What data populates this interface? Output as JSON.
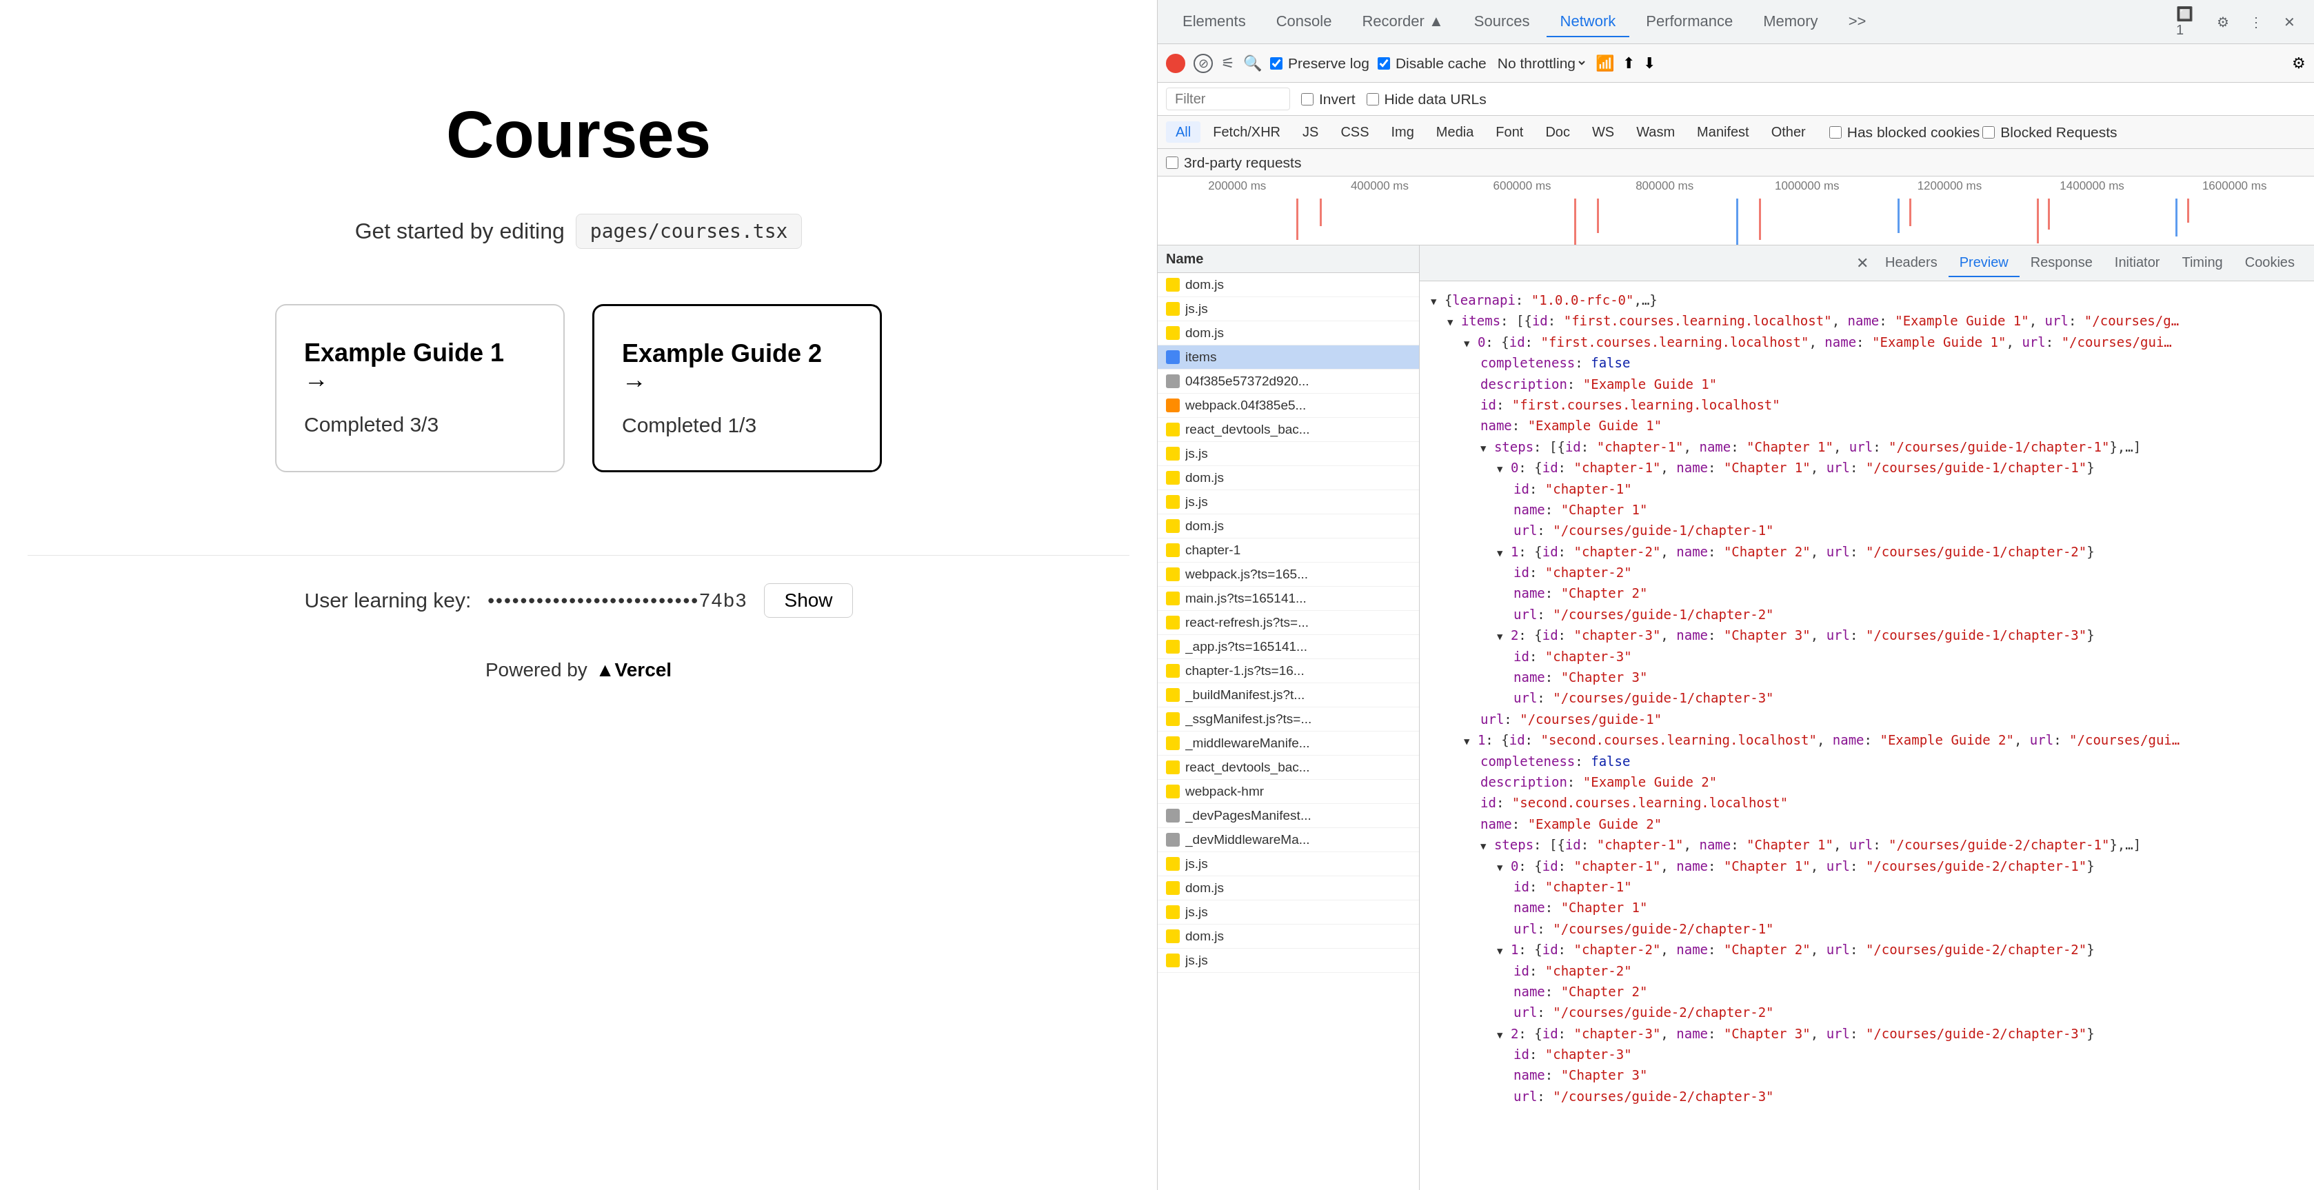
{
  "webpage": {
    "title": "Courses",
    "editHint": {
      "prefix": "Get started by editing",
      "file": "pages/courses.tsx"
    },
    "guides": [
      {
        "title": "Example Guide 1 →",
        "progress": "Completed 3/3",
        "active": false
      },
      {
        "title": "Example Guide 2 →",
        "progress": "Completed 1/3",
        "active": true
      }
    ],
    "learningKey": {
      "label": "User learning key:",
      "value": "••••••••••••••••••••••••••74b3",
      "showBtn": "Show"
    },
    "poweredBy": "Powered by",
    "vercel": "▲Vercel"
  },
  "devtools": {
    "tabs": [
      {
        "label": "Elements"
      },
      {
        "label": "Console"
      },
      {
        "label": "Recorder ▲"
      },
      {
        "label": "Sources"
      },
      {
        "label": "Network",
        "active": true
      },
      {
        "label": "Performance"
      },
      {
        "label": "Memory"
      },
      {
        "label": ">>"
      }
    ],
    "toolbar": {
      "preserveLog": "Preserve log",
      "disableCache": "Disable cache",
      "noThrottling": "No throttling",
      "invert": "Invert",
      "hideDataUrls": "Hide data URLs"
    },
    "filterTypes": [
      "All",
      "Fetch/XHR",
      "JS",
      "CSS",
      "Img",
      "Media",
      "Font",
      "Doc",
      "WS",
      "Wasm",
      "Manifest",
      "Other"
    ],
    "extraFilters": [
      "Has blocked cookies",
      "Blocked Requests"
    ],
    "thirdParty": "3rd-party requests",
    "timelineMarkers": [
      "200000 ms",
      "400000 ms",
      "600000 ms",
      "800000 ms",
      "1000000 ms",
      "1200000 ms",
      "1400000 ms",
      "1600000 ms"
    ],
    "panelTabs": [
      "Headers",
      "Preview",
      "Response",
      "Initiator",
      "Timing",
      "Cookies"
    ],
    "activeTab": "Preview",
    "files": [
      {
        "name": "dom.js",
        "type": "yellow"
      },
      {
        "name": "js.js",
        "type": "yellow"
      },
      {
        "name": "dom.js",
        "type": "yellow"
      },
      {
        "name": "items",
        "type": "blue",
        "selected": true
      },
      {
        "name": "04f385e57372d920...",
        "type": "gray"
      },
      {
        "name": "webpack.04f385e5...",
        "type": "orange"
      },
      {
        "name": "react_devtools_bac...",
        "type": "yellow"
      },
      {
        "name": "js.js",
        "type": "yellow"
      },
      {
        "name": "dom.js",
        "type": "yellow"
      },
      {
        "name": "js.js",
        "type": "yellow"
      },
      {
        "name": "dom.js",
        "type": "yellow"
      },
      {
        "name": "chapter-1",
        "type": "yellow"
      },
      {
        "name": "webpack.js?ts=165...",
        "type": "yellow"
      },
      {
        "name": "main.js?ts=165141...",
        "type": "yellow"
      },
      {
        "name": "react-refresh.js?ts=...",
        "type": "yellow"
      },
      {
        "name": "_app.js?ts=165141...",
        "type": "yellow"
      },
      {
        "name": "chapter-1.js?ts=16...",
        "type": "yellow"
      },
      {
        "name": "_buildManifest.js?t...",
        "type": "yellow"
      },
      {
        "name": "_ssgManifest.js?ts=...",
        "type": "yellow"
      },
      {
        "name": "_middlewareManife...",
        "type": "yellow"
      },
      {
        "name": "react_devtools_bac...",
        "type": "yellow"
      },
      {
        "name": "webpack-hmr",
        "type": "yellow"
      },
      {
        "name": "_devPagesManifest...",
        "type": "gray"
      },
      {
        "name": "_devMiddlewareMa...",
        "type": "gray"
      },
      {
        "name": "js.js",
        "type": "yellow"
      },
      {
        "name": "dom.js",
        "type": "yellow"
      },
      {
        "name": "js.js",
        "type": "yellow"
      },
      {
        "name": "dom.js",
        "type": "yellow"
      },
      {
        "name": "js.js",
        "type": "yellow"
      }
    ],
    "nameColumnHeader": "Name",
    "previewContent": {
      "lines": [
        "▼ {learnapi: \"1.0.0-rfc-0\",…}",
        "  ▼ items: [{id: \"first.courses.learning.localhost\", name: \"Example Guide 1\", url: \"/courses/g…",
        "    ▼ 0: {id: \"first.courses.learning.localhost\", name: \"Example Guide 1\", url: \"/courses/gui…",
        "        completeness: false",
        "        description: \"Example Guide 1\"",
        "        id: \"first.courses.learning.localhost\"",
        "        name: \"Example Guide 1\"",
        "      ▼ steps: [{id: \"chapter-1\", name: \"Chapter 1\", url: \"/courses/guide-1/chapter-1\"},…]",
        "        ▼ 0: {id: \"chapter-1\", name: \"Chapter 1\", url: \"/courses/guide-1/chapter-1\"}",
        "            id: \"chapter-1\"",
        "            name: \"Chapter 1\"",
        "            url: \"/courses/guide-1/chapter-1\"",
        "        ▼ 1: {id: \"chapter-2\", name: \"Chapter 2\", url: \"/courses/guide-1/chapter-2\"}",
        "            id: \"chapter-2\"",
        "            name: \"Chapter 2\"",
        "            url: \"/courses/guide-1/chapter-2\"",
        "        ▼ 2: {id: \"chapter-3\", name: \"Chapter 3\", url: \"/courses/guide-1/chapter-3\"}",
        "            id: \"chapter-3\"",
        "            name: \"Chapter 3\"",
        "            url: \"/courses/guide-1/chapter-3\"",
        "        url: \"/courses/guide-1\"",
        "    ▼ 1: {id: \"second.courses.learning.localhost\", name: \"Example Guide 2\", url: \"/courses/gui…",
        "        completeness: false",
        "        description: \"Example Guide 2\"",
        "        id: \"second.courses.learning.localhost\"",
        "        name: \"Example Guide 2\"",
        "      ▼ steps: [{id: \"chapter-1\", name: \"Chapter 1\", url: \"/courses/guide-2/chapter-1\"},…]",
        "        ▼ 0: {id: \"chapter-1\", name: \"Chapter 1\", url: \"/courses/guide-2/chapter-1\"}",
        "            id: \"chapter-1\"",
        "            name: \"Chapter 1\"",
        "            url: \"/courses/guide-2/chapter-1\"",
        "        ▼ 1: {id: \"chapter-2\", name: \"Chapter 2\", url: \"/courses/guide-2/chapter-2\"}",
        "            id: \"chapter-2\"",
        "            name: \"Chapter 2\"",
        "            url: \"/courses/guide-2/chapter-2\"",
        "        ▼ 2: {id: \"chapter-3\", name: \"Chapter 3\", url: \"/courses/guide-2/chapter-3\"}",
        "            id: \"chapter-3\"",
        "            name: \"Chapter 3\"",
        "            url: \"/courses/guide-2/chapter-3\""
      ]
    }
  }
}
